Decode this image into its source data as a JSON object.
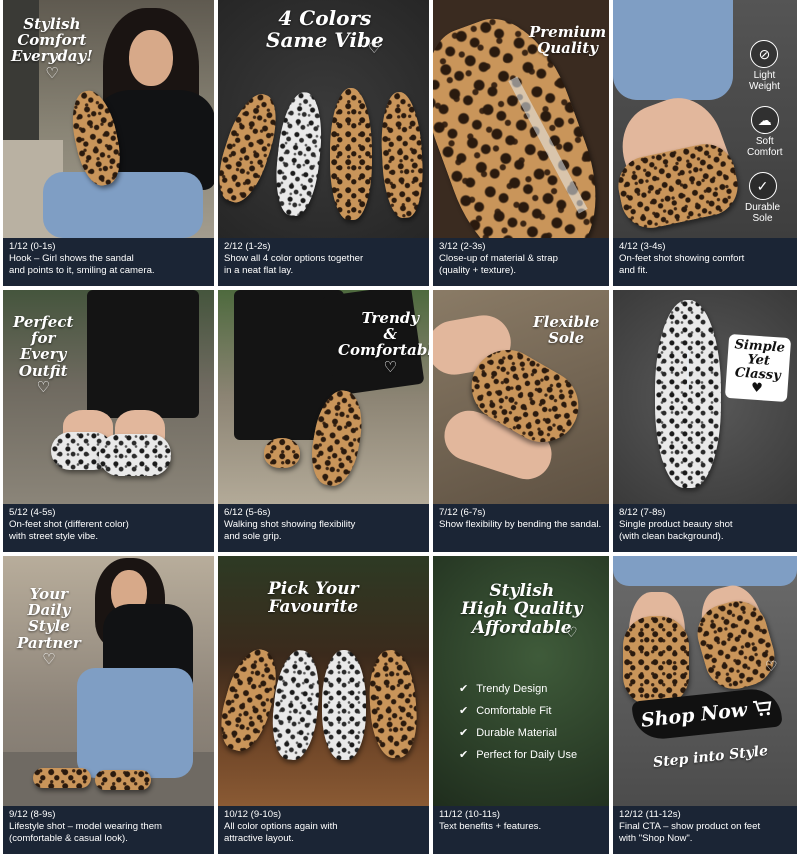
{
  "panels": [
    {
      "overlay": [
        "Stylish",
        "Comfort",
        "Everyday!"
      ],
      "heart": "♡",
      "caption": [
        "1/12 (0-1s)",
        "Hook – Girl shows the sandal",
        "and points to it, smiling at camera."
      ]
    },
    {
      "overlay": [
        "4 Colors",
        "Same Vibe"
      ],
      "heart": "♡",
      "caption": [
        "2/12 (1-2s)",
        "Show all 4 color options together",
        "in a neat flat lay."
      ]
    },
    {
      "overlay": [
        "Premium",
        "Quality"
      ],
      "caption": [
        "3/12 (2-3s)",
        "Close-up of material & strap",
        "(quality + texture)."
      ]
    },
    {
      "features": [
        {
          "icon": "leaf-icon",
          "glyph": "⊘",
          "label": [
            "Light",
            "Weight"
          ]
        },
        {
          "icon": "cloud-icon",
          "glyph": "☁",
          "label": [
            "Soft",
            "Comfort"
          ]
        },
        {
          "icon": "shield-check-icon",
          "glyph": "✓",
          "label": [
            "Durable",
            "Sole"
          ]
        }
      ],
      "caption": [
        "4/12 (3-4s)",
        "On-feet shot showing comfort",
        "and fit."
      ]
    },
    {
      "overlay": [
        "Perfect",
        "for",
        "Every",
        "Outfit"
      ],
      "heart": "♡",
      "caption": [
        "5/12 (4-5s)",
        "On-feet shot (different color)",
        "with street style vibe."
      ]
    },
    {
      "overlay": [
        "Trendy",
        "&",
        "Comfortable"
      ],
      "heart": "♡",
      "caption": [
        "6/12 (5-6s)",
        "Walking shot showing flexibility",
        "and sole grip."
      ]
    },
    {
      "overlay": [
        "Flexible",
        "Sole"
      ],
      "caption": [
        "7/12 (6-7s)",
        "Show flexibility by bending the sandal."
      ]
    },
    {
      "overlay": [
        "Simple",
        "Yet",
        "Classy"
      ],
      "heart": "♥",
      "caption": [
        "8/12 (7-8s)",
        "Single product beauty shot",
        "(with clean background)."
      ]
    },
    {
      "overlay": [
        "Your",
        "Daily",
        "Style",
        "Partner"
      ],
      "heart": "♡",
      "caption": [
        "9/12 (8-9s)",
        "Lifestyle shot – model wearing them",
        "(comfortable & casual look)."
      ]
    },
    {
      "overlay": [
        "Pick Your",
        "Favourite"
      ],
      "caption": [
        "10/12 (9-10s)",
        "All color options again with",
        "attractive layout."
      ]
    },
    {
      "overlay": [
        "Stylish",
        "High Quality",
        "Affordable"
      ],
      "heart": "♡",
      "benefits": [
        "Trendy Design",
        "Comfortable Fit",
        "Durable Material",
        "Perfect for Daily Use"
      ],
      "caption": [
        "11/12 (10-11s)",
        "Text benefits + features."
      ]
    },
    {
      "shop_now": "Shop Now",
      "tagline": "Step into Style",
      "heart": "♡",
      "caption": [
        "12/12 (11-12s)",
        "Final CTA – show product on feet",
        "with \"Shop Now\"."
      ]
    }
  ],
  "colors": {
    "caption_bg": "#1b2535",
    "leopard": "#c9955a",
    "snow_leopard": "#e9e9e9",
    "denim": "#7f9ec4"
  }
}
